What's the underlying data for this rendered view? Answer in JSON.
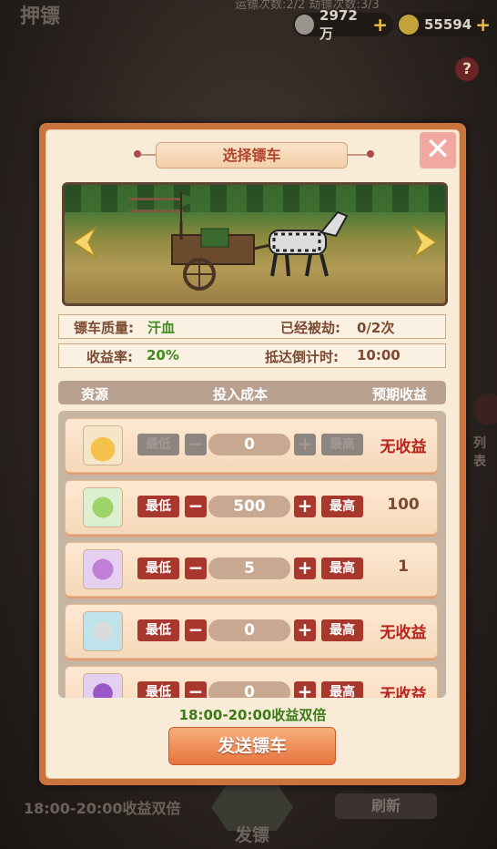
{
  "background": {
    "title": "押镖",
    "stats_text": "运镖次数:2/2  劫镖次数:3/3",
    "silver": "2972万",
    "gold": "55594",
    "help": "?",
    "bottom_note": "18:00-20:00收益双倍",
    "refresh_label": "刷新",
    "send_label": "发镖",
    "side_label": "列表"
  },
  "modal": {
    "title": "选择镖车",
    "close": "✕",
    "quality_label": "镖车质量:",
    "quality_value": "汗血",
    "robbed_label": "已经被劫:",
    "robbed_value": "0/2次",
    "rate_label": "收益率:",
    "rate_value": "20%",
    "countdown_label": "抵达倒计时:",
    "countdown_value": "10:00",
    "columns": {
      "resource": "资源",
      "cost": "投入成本",
      "expected": "预期收益"
    },
    "rows": [
      {
        "icon": "gold-ingot-icon",
        "min": "最低",
        "minus": "−",
        "qty": "0",
        "plus": "+",
        "max": "最高",
        "earn": "无收益",
        "disabled": true
      },
      {
        "icon": "green-dumplings-icon",
        "min": "最低",
        "minus": "−",
        "qty": "500",
        "plus": "+",
        "max": "最高",
        "earn": "100",
        "disabled": false
      },
      {
        "icon": "purple-crystal-icon",
        "min": "最低",
        "minus": "−",
        "qty": "5",
        "plus": "+",
        "max": "最高",
        "earn": "1",
        "disabled": false
      },
      {
        "icon": "silver-coin-icon",
        "min": "最低",
        "minus": "−",
        "qty": "0",
        "plus": "+",
        "max": "最高",
        "earn": "无收益",
        "disabled": false
      },
      {
        "icon": "potion-bottle-icon",
        "min": "最低",
        "minus": "−",
        "qty": "0",
        "plus": "+",
        "max": "最高",
        "earn": "无收益",
        "disabled": false
      }
    ],
    "double_note": "18:00-20:00收益双倍",
    "send_button": "发送镖车"
  },
  "colors": {
    "accent": "#a8382e",
    "frame": "#c9733d",
    "panel": "#f8ecd9",
    "green": "#3f8a1c"
  }
}
